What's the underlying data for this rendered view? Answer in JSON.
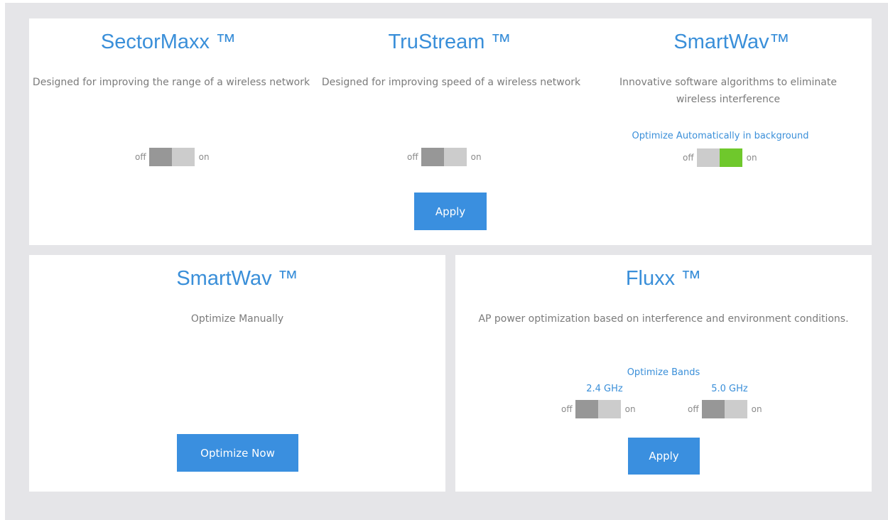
{
  "features": {
    "sectormaxx": {
      "title": "SectorMaxx ™",
      "description": "Designed for improving the range of a wireless network",
      "toggle": {
        "off_label": "off",
        "on_label": "on",
        "state": "off"
      }
    },
    "trustream": {
      "title": "TruStream ™",
      "description": "Designed for improving speed of a wireless network",
      "toggle": {
        "off_label": "off",
        "on_label": "on",
        "state": "off"
      }
    },
    "smartwav_auto": {
      "title": "SmartWav™",
      "description": "Innovative software algorithms to eliminate wireless interference",
      "optimize_label": "Optimize Automatically in background",
      "toggle": {
        "off_label": "off",
        "on_label": "on",
        "state": "on",
        "on_color": "#6fc82c"
      }
    },
    "apply_label": "Apply"
  },
  "smartwav_manual": {
    "title": "SmartWav ™",
    "description": "Optimize Manually",
    "button_label": "Optimize Now"
  },
  "fluxx": {
    "title": "Fluxx ™",
    "description": "AP power optimization based on interference and environment conditions.",
    "bands_label": "Optimize Bands",
    "band_24": {
      "label": "2.4 GHz",
      "off_label": "off",
      "on_label": "on",
      "state": "off"
    },
    "band_50": {
      "label": "5.0 GHz",
      "off_label": "off",
      "on_label": "on",
      "state": "off"
    },
    "apply_label": "Apply"
  },
  "colors": {
    "accent": "#3a8fd9",
    "button": "#3a8fdf",
    "toggle_on": "#6fc82c",
    "toggle_knob": "#979797",
    "toggle_track": "#cccccc",
    "background": "#e5e5e8"
  }
}
